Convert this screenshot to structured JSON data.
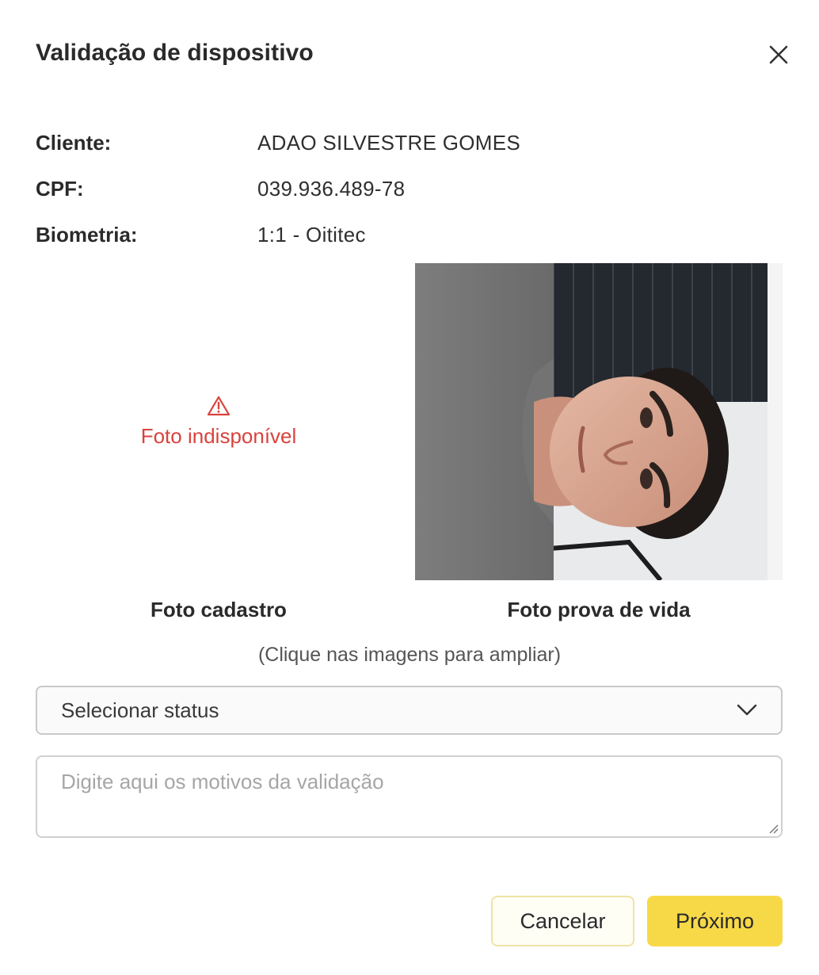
{
  "dialog": {
    "title": "Validação de dispositivo",
    "close_icon": "close-icon"
  },
  "info": {
    "client_label": "Cliente:",
    "client_value": "ADAO SILVESTRE GOMES",
    "cpf_label": "CPF:",
    "cpf_value": "039.936.489-78",
    "biometry_label": "Biometria:",
    "biometry_value": "1:1 - Oititec"
  },
  "photos": {
    "left": {
      "unavailable_icon": "warning-icon",
      "unavailable_text": "Foto indisponível",
      "caption": "Foto cadastro"
    },
    "right": {
      "caption": "Foto prova de vida"
    },
    "hint": "(Clique nas imagens para ampliar)"
  },
  "form": {
    "status_select": {
      "selected": "Selecionar status",
      "icon": "chevron-down-icon"
    },
    "reason_textarea": {
      "value": "",
      "placeholder": "Digite aqui os motivos da validação"
    }
  },
  "actions": {
    "cancel_label": "Cancelar",
    "next_label": "Próximo"
  },
  "colors": {
    "error_red": "#d9433d",
    "primary_yellow": "#f7d948",
    "cancel_border": "#efe3a5"
  }
}
